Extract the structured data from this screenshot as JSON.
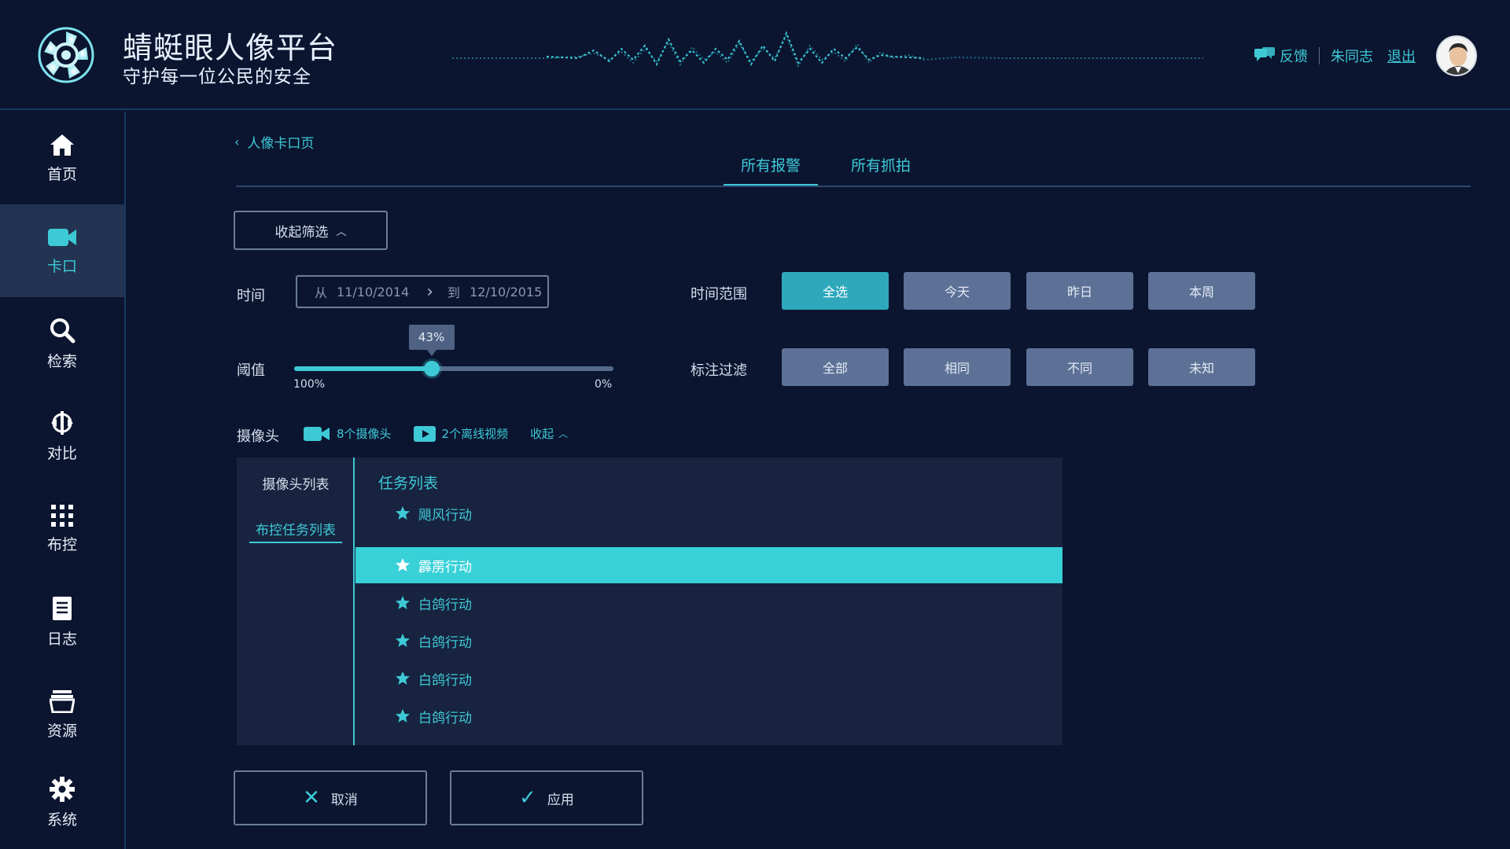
{
  "app": {
    "title": "蜻蜓眼人像平台",
    "slogan": "守护每一位公民的安全"
  },
  "header": {
    "feedback_label": "反馈",
    "username": "朱同志",
    "logout_label": "退出"
  },
  "sidebar": {
    "items": [
      {
        "label": "首页",
        "icon": "home-icon"
      },
      {
        "label": "卡口",
        "icon": "camera-icon",
        "active": true
      },
      {
        "label": "检索",
        "icon": "search-icon"
      },
      {
        "label": "对比",
        "icon": "compare-icon"
      },
      {
        "label": "布控",
        "icon": "grid-icon"
      },
      {
        "label": "日志",
        "icon": "document-icon"
      },
      {
        "label": "资源",
        "icon": "folder-icon"
      },
      {
        "label": "系统",
        "icon": "gear-icon"
      }
    ]
  },
  "breadcrumb": {
    "back_label": "人像卡口页"
  },
  "tabs": [
    {
      "label": "所有报警",
      "active": true
    },
    {
      "label": "所有抓拍",
      "active": false
    }
  ],
  "filter": {
    "collapse_label": "收起筛选",
    "time_label": "时间",
    "date_from_prefix": "从",
    "date_from": "11/10/2014",
    "date_to_prefix": "到",
    "date_to": "12/10/2015",
    "time_range_label": "时间范围",
    "time_range_options": [
      "全选",
      "今天",
      "昨日",
      "本周"
    ],
    "time_range_selected": "全选",
    "threshold_label": "阈值",
    "threshold_value": 43,
    "threshold_value_text": "43%",
    "threshold_left_label": "100%",
    "threshold_right_label": "0%",
    "annotation_label": "标注过滤",
    "annotation_options": [
      "全部",
      "相同",
      "不同",
      "未知"
    ]
  },
  "camera": {
    "label": "摄像头",
    "cameras_count_label": "8个摄像头",
    "offline_videos_label": "2个离线视频",
    "collapse_label": "收起"
  },
  "panel": {
    "left_tabs": [
      "摄像头列表",
      "布控任务列表"
    ],
    "active_left_tab": "布控任务列表",
    "title": "任务列表",
    "tasks": [
      {
        "name": "飓风行动",
        "selected": false
      },
      {
        "name": "霹雳行动",
        "selected": true
      },
      {
        "name": "白鸽行动",
        "selected": false
      },
      {
        "name": "白鸽行动",
        "selected": false
      },
      {
        "name": "白鸽行动",
        "selected": false
      },
      {
        "name": "白鸽行动",
        "selected": false
      }
    ]
  },
  "actions": {
    "cancel_label": "取消",
    "apply_label": "应用"
  },
  "colors": {
    "background": "#0b1530",
    "accent": "#3ec9d6",
    "button_fill": "#5d7196",
    "panel": "#17233f"
  }
}
